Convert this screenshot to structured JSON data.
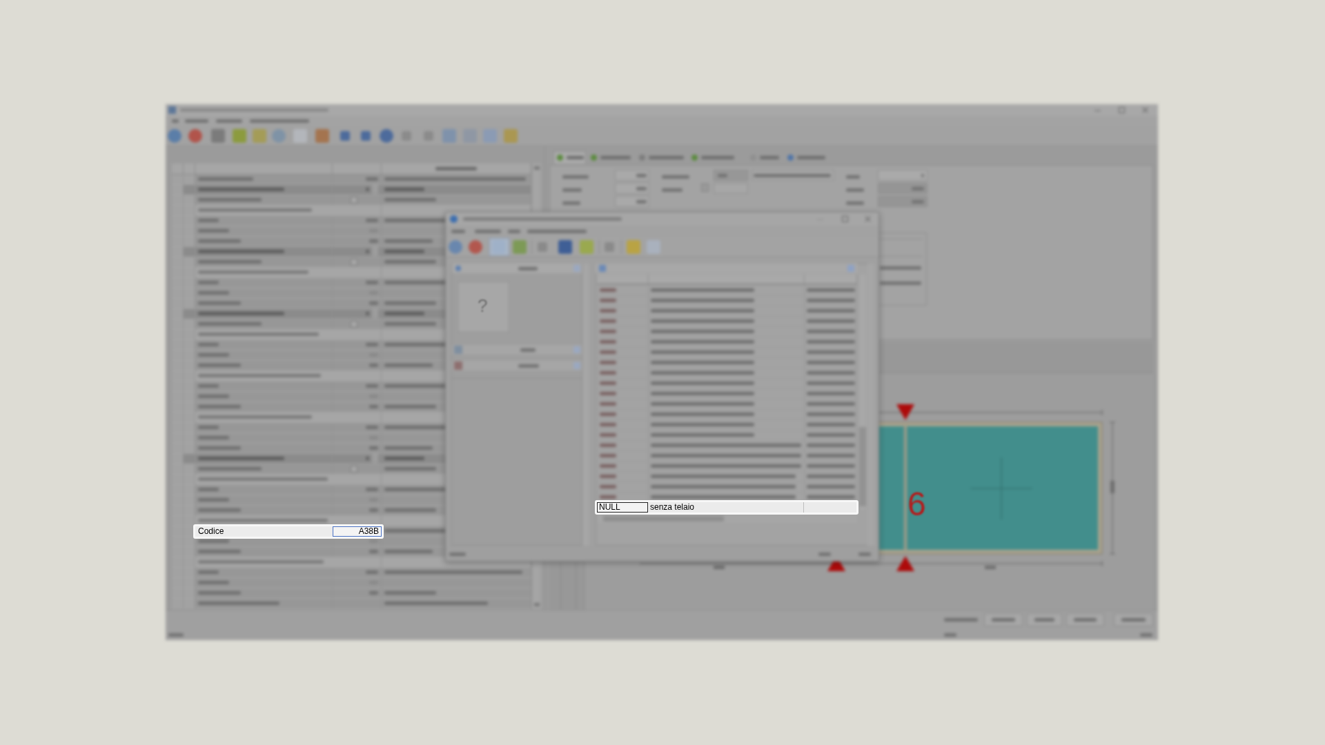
{
  "property_grid": {
    "focused_row": {
      "label": "Codice",
      "value": "A38B"
    }
  },
  "lookup_dialog": {
    "preview": {
      "symbol": "?"
    },
    "focused_row": {
      "code": "NULL",
      "description": "senza telaio"
    }
  },
  "frame_drawing": {
    "sash_number": "6"
  }
}
